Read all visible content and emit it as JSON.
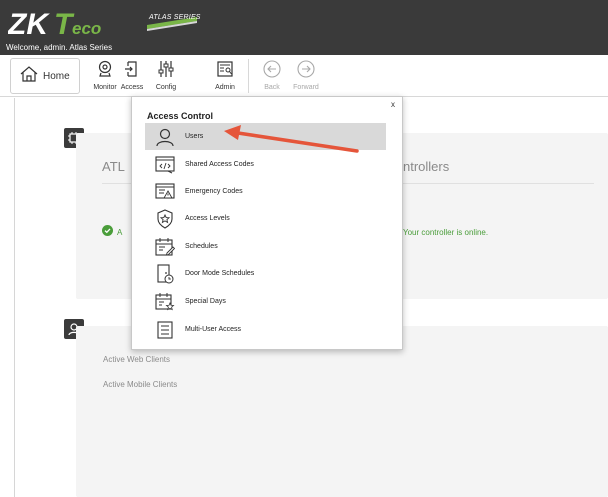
{
  "header": {
    "logo_text": "ZKTeco",
    "welcome": "Welcome, admin.  Atlas Series",
    "series_badge": "ATLAS SERIES"
  },
  "toolbar": {
    "home": "Home",
    "items": [
      {
        "label": "Monitor",
        "icon": "webcam-icon"
      },
      {
        "label": "Access",
        "icon": "door-icon"
      },
      {
        "label": "Config",
        "icon": "sliders-icon"
      },
      {
        "label": "Admin",
        "icon": "admin-icon"
      },
      {
        "label": "Back",
        "icon": "back-arrow-icon"
      },
      {
        "label": "Forward",
        "icon": "forward-arrow-icon"
      }
    ]
  },
  "cards": {
    "controllers": {
      "title_left": "ATL",
      "title_right": "ntrollers",
      "status_left": "A",
      "status_right": "Your controller is online."
    },
    "clients": {
      "web": "Active Web Clients",
      "mobile": "Active Mobile Clients"
    }
  },
  "dropdown": {
    "title": "Access Control",
    "close": "x",
    "items": [
      {
        "label": "Users",
        "icon": "user-icon"
      },
      {
        "label": "Shared Access Codes",
        "icon": "code-window-icon"
      },
      {
        "label": "Emergency Codes",
        "icon": "emergency-code-icon"
      },
      {
        "label": "Access Levels",
        "icon": "shield-star-icon"
      },
      {
        "label": "Schedules",
        "icon": "calendar-edit-icon"
      },
      {
        "label": "Door Mode Schedules",
        "icon": "door-clock-icon"
      },
      {
        "label": "Special Days",
        "icon": "calendar-star-icon"
      },
      {
        "label": "Multi-User Access",
        "icon": "list-document-icon"
      }
    ]
  },
  "colors": {
    "header_bg": "#3a3a3a",
    "accent_green": "#7ab648",
    "status_green": "#4a9d3a",
    "arrow_red": "#e5553a"
  }
}
